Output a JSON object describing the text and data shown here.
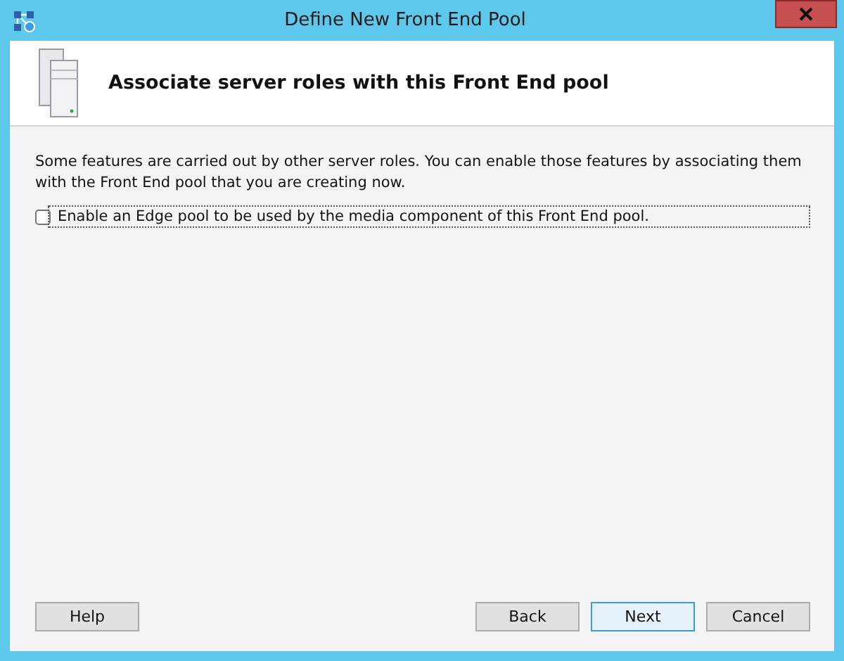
{
  "window": {
    "title": "Define New Front End Pool"
  },
  "header": {
    "title": "Associate server roles with this Front End pool"
  },
  "description": "Some features are carried out by other server roles. You can enable those features by associating them with the Front End pool that you are creating now.",
  "options": [
    {
      "label": "Enable an Edge pool to be used by the media component of this Front End pool.",
      "checked": false,
      "focused": true
    }
  ],
  "buttons": [
    {
      "label": "Help",
      "kind": "help",
      "focused": false
    },
    {
      "label": "Back",
      "kind": "nav",
      "focused": false
    },
    {
      "label": "Next",
      "kind": "nav",
      "focused": true
    },
    {
      "label": "Cancel",
      "kind": "nav",
      "focused": false
    }
  ]
}
